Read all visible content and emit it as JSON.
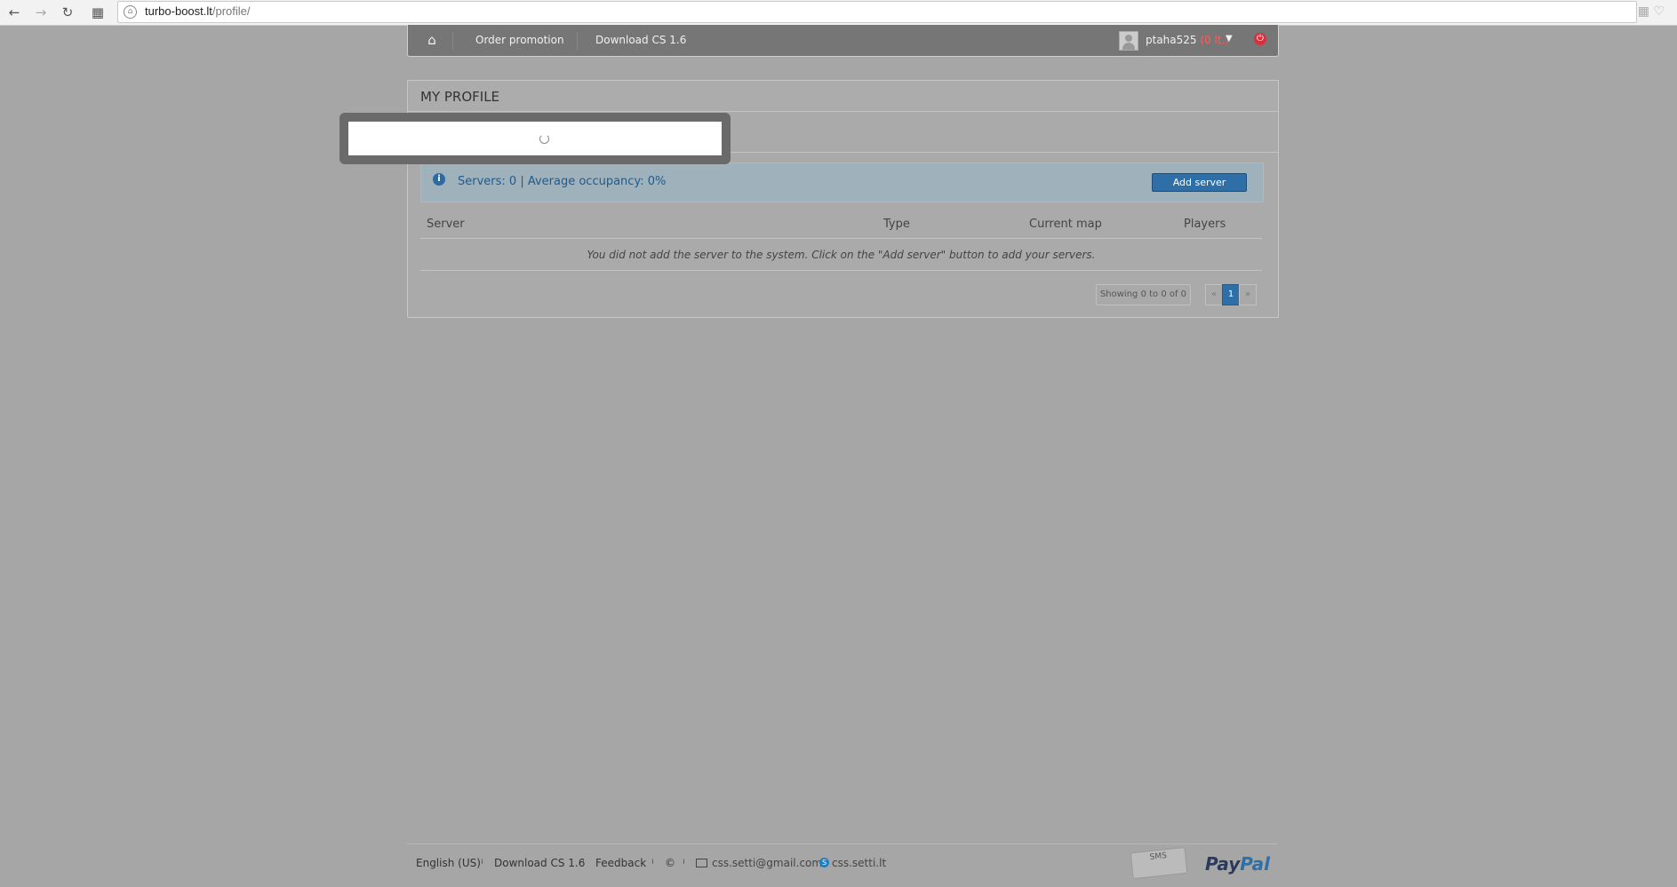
{
  "browser": {
    "url_domain": "turbo-boost.lt",
    "url_path": "/profile/"
  },
  "topnav": {
    "order_promotion": "Order promotion",
    "download": "Download CS 1.6",
    "username": "ptaha525",
    "balance": "(0 lt.)"
  },
  "profile": {
    "title": "MY PROFILE",
    "stats": "Servers: 0 | Average occupancy: 0%",
    "add_server": "Add server",
    "columns": [
      "Server",
      "Type",
      "Current map",
      "Players"
    ],
    "empty_message": "You did not add the server to the system. Click on the \"Add server\" button to add your servers.",
    "showing": "Showing 0 to 0 of 0",
    "pager": {
      "prev": "«",
      "page": "1",
      "next": "»"
    }
  },
  "footer": {
    "language": "English (US)",
    "download": "Download CS 1.6",
    "feedback": "Feedback",
    "copyright": "©",
    "email": "css.setti@gmail.com",
    "skype": "css.setti.lt",
    "sms_logo": "SMS",
    "paypal_pay": "Pay",
    "paypal_pal": "Pal"
  }
}
